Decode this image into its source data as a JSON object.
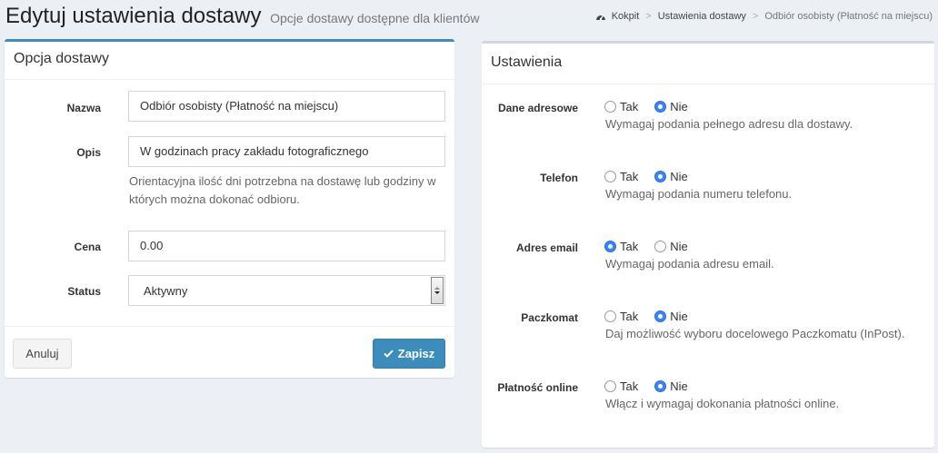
{
  "header": {
    "title": "Edytuj ustawienia dostawy",
    "subtitle": "Opcje dostawy dostępne dla klientów"
  },
  "breadcrumb": {
    "home": "Kokpit",
    "level1": "Ustawienia dostawy",
    "current": "Odbiór osobisty (Płatność na miejscu)",
    "home_icon": "dashboard-icon"
  },
  "delivery_box": {
    "title": "Opcja dostawy",
    "name_label": "Nazwa",
    "name_value": "Odbiór osobisty (Płatność na miejscu)",
    "desc_label": "Opis",
    "desc_value": "W godzinach pracy zakładu fotograficznego",
    "desc_help": "Orientacyjna ilość dni potrzebna na dostawę lub godziny w których można dokonać odbioru.",
    "price_label": "Cena",
    "price_value": "0.00",
    "status_label": "Status",
    "status_value": "Aktywny",
    "cancel_label": "Anuluj",
    "save_label": "Zapisz"
  },
  "settings_box": {
    "title": "Ustawienia",
    "yes_label": "Tak",
    "no_label": "Nie",
    "rows": [
      {
        "label": "Dane adresowe",
        "help": "Wymagaj podania pełnego adresu dla dostawy.",
        "selected": "no"
      },
      {
        "label": "Telefon",
        "help": "Wymagaj podania numeru telefonu.",
        "selected": "no"
      },
      {
        "label": "Adres email",
        "help": "Wymagaj podania adresu email.",
        "selected": "yes"
      },
      {
        "label": "Paczkomat",
        "help": "Daj możliwość wyboru docelowego Paczkomatu (InPost).",
        "selected": "no"
      },
      {
        "label": "Płatność online",
        "help": "Włącz i wymagaj dokonania płatności online.",
        "selected": "no"
      }
    ]
  },
  "colors": {
    "accent": "#3c8dbc",
    "radio_checked": "#3b84f5",
    "background": "#ecf0f5"
  }
}
